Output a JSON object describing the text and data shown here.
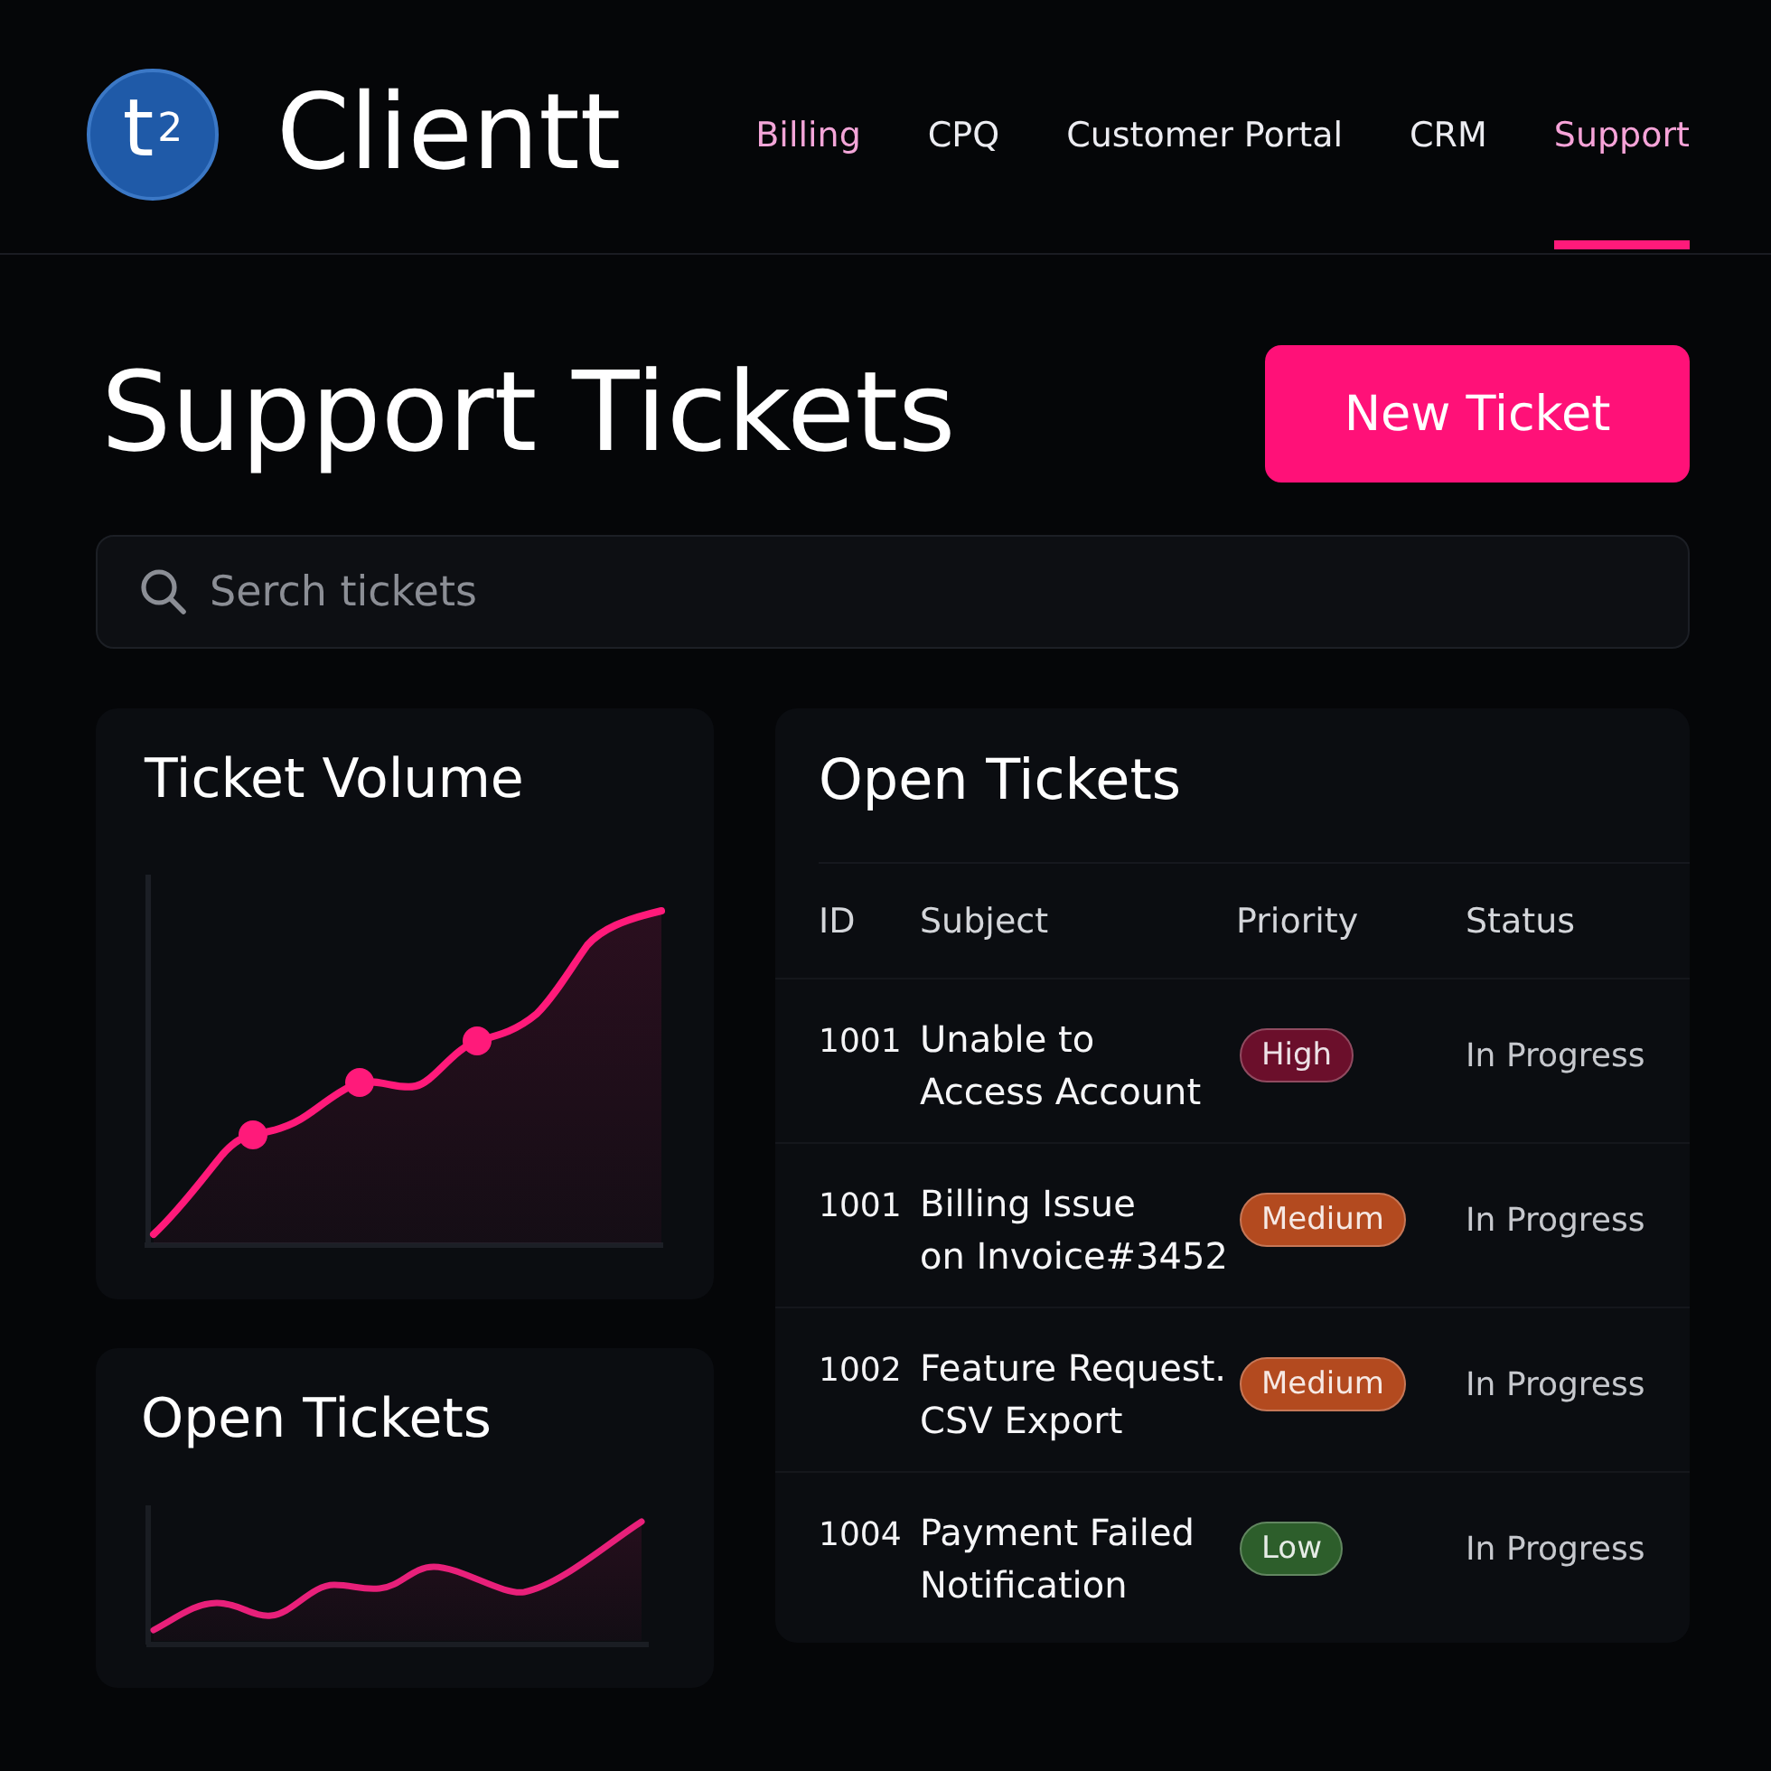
{
  "header": {
    "logo": {
      "mark": "t$^{2}$",
      "name": "Clientt"
    },
    "nav": [
      {
        "label": "Billing",
        "color": "#f3a5d8",
        "selected": false
      },
      {
        "label": "CPQ",
        "color": "#ececf1",
        "selected": false
      },
      {
        "label": "Customer Portal",
        "color": "#ececf1",
        "selected": false
      },
      {
        "label": "CRM",
        "color": "#ececf1",
        "selected": false
      },
      {
        "label": "Support",
        "color": "#f6a3d8",
        "selected": true
      }
    ]
  },
  "page": {
    "title": "Support Tickets",
    "new_button": "New Ticket"
  },
  "search": {
    "placeholder": "Serch tickets"
  },
  "ticket_volume": {
    "title": "Ticket Volume"
  },
  "open_tickets_trend": {
    "title": "Open Tickets"
  },
  "table": {
    "title": "Open Tickets",
    "columns": [
      "ID",
      "Subject",
      "Priority",
      "Status"
    ],
    "rows": [
      {
        "id": "1001",
        "subject": "Unable to\nAccess Account",
        "priority": {
          "label": "High",
          "color": "#6b0f2b"
        },
        "status": "In Progress"
      },
      {
        "id": "1001",
        "subject": "Billing Issue\non Invoice#3452",
        "priority": {
          "label": "Medium",
          "color": "#b34a1f"
        },
        "status": "In Progress"
      },
      {
        "id": "1002",
        "subject": "Feature Request.\nCSV Export",
        "priority": {
          "label": "Medium",
          "color": "#b34a1f"
        },
        "status": "In Progress"
      },
      {
        "id": "1004",
        "subject": "Payment Failed\nNotification",
        "priority": {
          "label": "Low",
          "color": "#2d5e2b"
        },
        "status": "In Progress"
      }
    ]
  }
}
